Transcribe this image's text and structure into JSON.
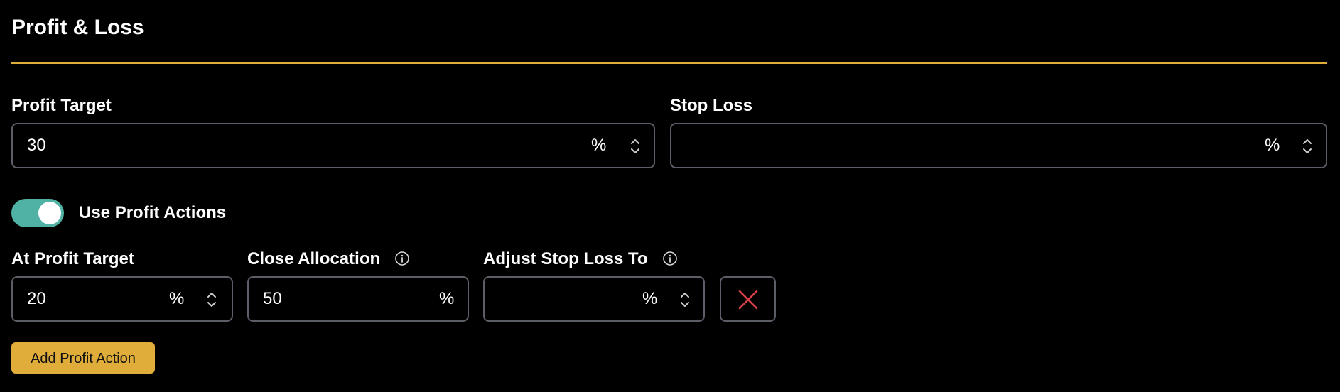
{
  "section": {
    "title": "Profit & Loss"
  },
  "profit_target": {
    "label": "Profit Target",
    "value": "30",
    "unit": "%"
  },
  "stop_loss": {
    "label": "Stop Loss",
    "value": "",
    "unit": "%"
  },
  "use_profit_actions": {
    "label": "Use Profit Actions",
    "enabled": true
  },
  "profit_action": {
    "at_profit_target": {
      "label": "At Profit Target",
      "value": "20",
      "unit": "%"
    },
    "close_allocation": {
      "label": "Close Allocation",
      "value": "50",
      "unit": "%"
    },
    "adjust_stop_loss": {
      "label": "Adjust Stop Loss To",
      "value": "",
      "unit": "%"
    }
  },
  "add_button": {
    "label": "Add Profit Action"
  },
  "icons": {
    "info": "info-icon",
    "spinner": "chevron-up-down-icon",
    "remove": "close-x-icon"
  },
  "colors": {
    "accent": "#e0ad3a",
    "toggle_on": "#4fb2a4",
    "remove_x": "#d9414a",
    "border": "#5b5e66"
  }
}
